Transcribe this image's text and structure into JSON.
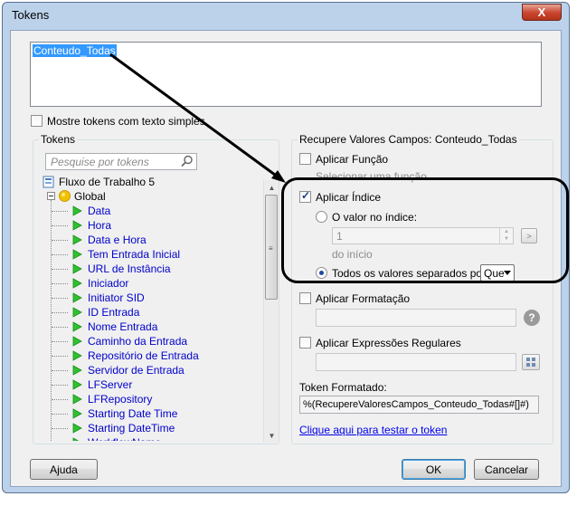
{
  "window": {
    "title": "Tokens",
    "close_label": "X"
  },
  "token_text": {
    "selected_value": "Conteudo_Todas"
  },
  "show_simple_text": {
    "label": "Mostre tokens com texto simples",
    "checked": false
  },
  "tokens_panel": {
    "title": "Tokens",
    "search_placeholder": "Pesquise por tokens",
    "root_label": "Fluxo de Trabalho 5",
    "global_label": "Global",
    "items": [
      "Data",
      "Hora",
      "Data e Hora",
      "Tem Entrada Inicial",
      "URL de Instância",
      "Iniciador",
      "Initiator SID",
      "ID Entrada",
      "Nome Entrada",
      "Caminho da Entrada",
      "Repositório de Entrada",
      "Servidor de Entrada",
      "LFServer",
      "LFRepository",
      "Starting Date Time",
      "Starting DateTime",
      "WorkflowName"
    ],
    "scroll_up_glyph": "▲",
    "scroll_down_glyph": "▼",
    "thumb_glyph": "≡"
  },
  "options_panel": {
    "title": "Recupere Valores Campos: Conteudo_Todas",
    "apply_function": {
      "label": "Aplicar Função",
      "checked": false,
      "hint": "Selecionar uma função"
    },
    "apply_index": {
      "label": "Aplicar Índice",
      "checked": true,
      "value_at_index_label": "O valor no índice:",
      "index_value": "1",
      "index_button": ">",
      "from_label": "do  início",
      "all_values_label": "Todos os valores separados por:",
      "separator_value": "Que"
    },
    "apply_format": {
      "label": "Aplicar Formatação",
      "checked": false,
      "help_glyph": "?"
    },
    "apply_regex": {
      "label": "Aplicar Expressões Regulares",
      "checked": false
    },
    "formatted_token": {
      "label": "Token Formatado:",
      "value": "%(RecupereValoresCampos_Conteudo_Todas#[]#)"
    },
    "test_link": "Clique aqui para testar o token"
  },
  "footer": {
    "help_button": "Ajuda",
    "ok_button": "OK",
    "cancel_button": "Cancelar"
  },
  "colors": {
    "selection": "#3399ff",
    "token_link": "#0000cc",
    "play_icon": "#2ec22e",
    "global_icon": "#f2c200",
    "window_frame": "#bcd2ea"
  }
}
